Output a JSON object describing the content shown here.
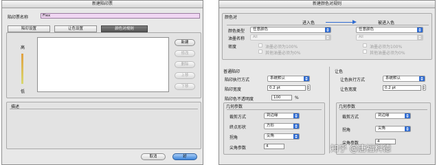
{
  "left_dialog": {
    "title": "新建陷印票",
    "name_label": "陷印票名称",
    "name_value": "Flex",
    "tabs": [
      "陷印设置",
      "让色设置",
      "颜色对规则"
    ],
    "axis_high": "高",
    "axis_low": "低",
    "buttons": [
      "新建",
      "修改",
      "删除",
      "上移",
      "下移"
    ],
    "description_label": "描述",
    "cancel": "取消",
    "ok": "好"
  },
  "right_dialog": {
    "title": "新建颜色对规则",
    "color_pair": {
      "section_label": "颜色对",
      "into_color_header": "进入色",
      "entered_color_header": "被进入色",
      "left": {
        "color_type_label": "颜色类型",
        "color_type_value": "任意颜色",
        "ink_name_label": "油墨名称",
        "ink_name_value": "All",
        "density_label": "密度",
        "ink_must_be": "油墨必须为100%",
        "other_inks_must_be": "其他油墨必须为0%"
      },
      "right": {
        "color_type_value": "任意颜色",
        "ink_name_value": "All",
        "ink_must_be": "油墨必须为100%",
        "other_inks_must_be": "其他油墨必须为0%"
      }
    },
    "normal_trap": {
      "section_label": "普通陷印",
      "method_label": "陷印执行方式",
      "method_value": "系统默认",
      "width_label": "陷印宽度",
      "width_value": "0.2 pt",
      "opacity_label": "陷印色不透明度",
      "opacity_value": "100",
      "opacity_unit": "%"
    },
    "knockout": {
      "section_label": "让色",
      "method_label": "让色执行方式",
      "method_value": "系统默认",
      "width_label": "让色宽度",
      "width_value": "0.2 pt"
    },
    "geometry_left": {
      "section_label": "几何参数",
      "clip_label": "裁剪方式",
      "clip_value": "到边缘",
      "end_label": "终点形状",
      "end_value": "方形",
      "corner_label": "拐角",
      "corner_value": "尖角",
      "miter_label": "尖角参数",
      "miter_value": "4"
    },
    "geometry_right": {
      "section_label": "几何参数",
      "clip_label": "裁剪方式",
      "clip_value": "到边缘",
      "corner_label": "拐角",
      "corner_value": "尖角",
      "miter_label": "尖角参数",
      "miter_value": "4"
    }
  },
  "watermark": "知乎 @唐福科德",
  "colors": {
    "accent": "#2f6bd1",
    "window": "#e8e8e8",
    "name_field": "#f0d6f2"
  }
}
